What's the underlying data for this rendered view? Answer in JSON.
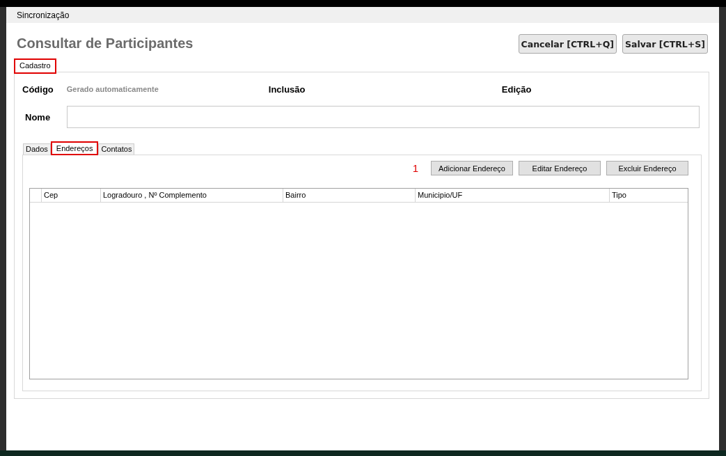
{
  "menu_bar": {
    "items": [
      "Sincronização"
    ]
  },
  "title": "Consultar de Participantes",
  "actions": [
    "Cancelar [CTRL+Q]",
    "Salvar [CTRL+S]"
  ],
  "tabs": [
    {
      "label": "Cadastro",
      "selected": true,
      "annotated": true
    }
  ],
  "form": {
    "codigo_label": "Código",
    "codigo_value": "Gerado automaticamente",
    "inclusao_label": "Inclusão",
    "edicao_label": "Edição",
    "nome_label": "Nome"
  },
  "sub_tabs": [
    {
      "label": "Dados",
      "selected": false,
      "annotated": false
    },
    {
      "label": "Endereços",
      "selected": true,
      "annotated": true
    },
    {
      "label": "Contatos",
      "selected": false,
      "annotated": false
    }
  ],
  "annotation_number": "1",
  "address_buttons": [
    "Adicionar Endereço",
    "Editar Endereço",
    "Excluir Endereço"
  ],
  "table": {
    "columns": [
      "Cep",
      "Logradouro , Nº Complemento",
      "Bairro",
      "Municipio/UF",
      "Tipo"
    ]
  }
}
